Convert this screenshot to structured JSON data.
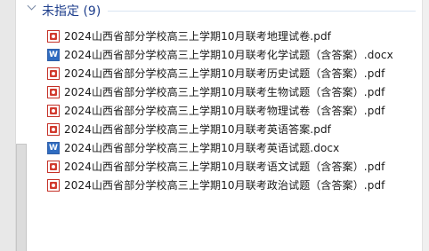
{
  "group": {
    "title": "未指定 (9)"
  },
  "files": [
    {
      "name": "2024山西省部分学校高三上学期10月联考地理试卷.pdf",
      "icon": "pdf-icon"
    },
    {
      "name": "2024山西省部分学校高三上学期10月联考化学试题（含答案）.docx",
      "icon": "docx-icon"
    },
    {
      "name": "2024山西省部分学校高三上学期10月联考历史试题（含答案）.pdf",
      "icon": "pdf-icon"
    },
    {
      "name": "2024山西省部分学校高三上学期10月联考生物试题（含答案）.pdf",
      "icon": "pdf-icon"
    },
    {
      "name": "2024山西省部分学校高三上学期10月联考物理试卷（含答案）.pdf",
      "icon": "pdf-icon"
    },
    {
      "name": "2024山西省部分学校高三上学期10月联考英语答案.pdf",
      "icon": "pdf-icon"
    },
    {
      "name": "2024山西省部分学校高三上学期10月联考英语试题.docx",
      "icon": "docx-icon"
    },
    {
      "name": "2024山西省部分学校高三上学期10月联考语文试题（含答案）.pdf",
      "icon": "pdf-icon"
    },
    {
      "name": "2024山西省部分学校高三上学期10月联考政治试题（含答案）.pdf",
      "icon": "pdf-icon"
    }
  ]
}
